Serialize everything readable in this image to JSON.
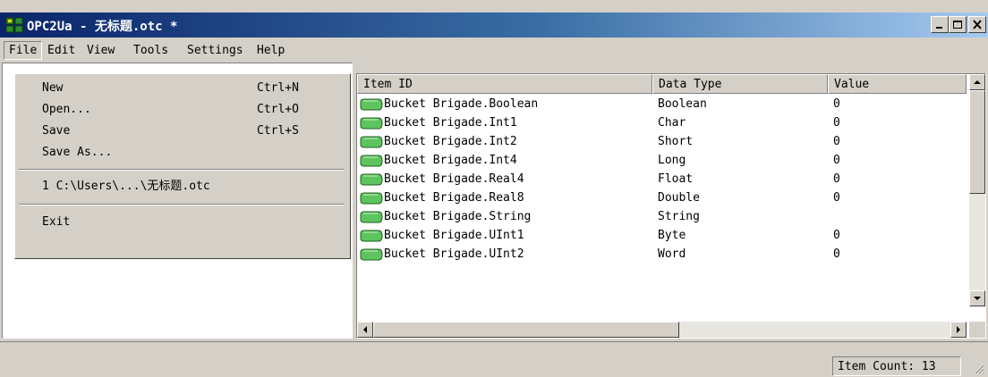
{
  "window": {
    "title": "OPC2Ua - 无标题.otc *",
    "titlebar_colors": [
      "#0a246a",
      "#3a6ea5",
      "#a6caf0"
    ]
  },
  "menubar": {
    "items": [
      "File",
      "Edit",
      "View",
      "Tools",
      "Settings",
      "Help"
    ],
    "open_menu": "File"
  },
  "file_menu": {
    "items": [
      {
        "label": "New",
        "shortcut": "Ctrl+N"
      },
      {
        "label": "Open...",
        "shortcut": "Ctrl+O"
      },
      {
        "label": "Save",
        "shortcut": "Ctrl+S"
      },
      {
        "label": "Save As...",
        "shortcut": ""
      },
      {
        "label": "1 C:\\Users\\...\\无标题.otc",
        "shortcut": ""
      },
      {
        "label": "Exit",
        "shortcut": ""
      }
    ]
  },
  "list": {
    "columns": [
      "Item ID",
      "Data Type",
      "Value"
    ],
    "rows": [
      {
        "id": "Bucket Brigade.Boolean",
        "type": "Boolean",
        "value": "0"
      },
      {
        "id": "Bucket Brigade.Int1",
        "type": "Char",
        "value": "0"
      },
      {
        "id": "Bucket Brigade.Int2",
        "type": "Short",
        "value": "0"
      },
      {
        "id": "Bucket Brigade.Int4",
        "type": "Long",
        "value": "0"
      },
      {
        "id": "Bucket Brigade.Real4",
        "type": "Float",
        "value": "0"
      },
      {
        "id": "Bucket Brigade.Real8",
        "type": "Double",
        "value": "0"
      },
      {
        "id": "Bucket Brigade.String",
        "type": "String",
        "value": ""
      },
      {
        "id": "Bucket Brigade.UInt1",
        "type": "Byte",
        "value": "0"
      },
      {
        "id": "Bucket Brigade.UInt2",
        "type": "Word",
        "value": "0"
      }
    ],
    "item_icon": "tag-icon",
    "item_icon_color": "#5ec45e"
  },
  "statusbar": {
    "item_count": "Item Count: 13"
  }
}
